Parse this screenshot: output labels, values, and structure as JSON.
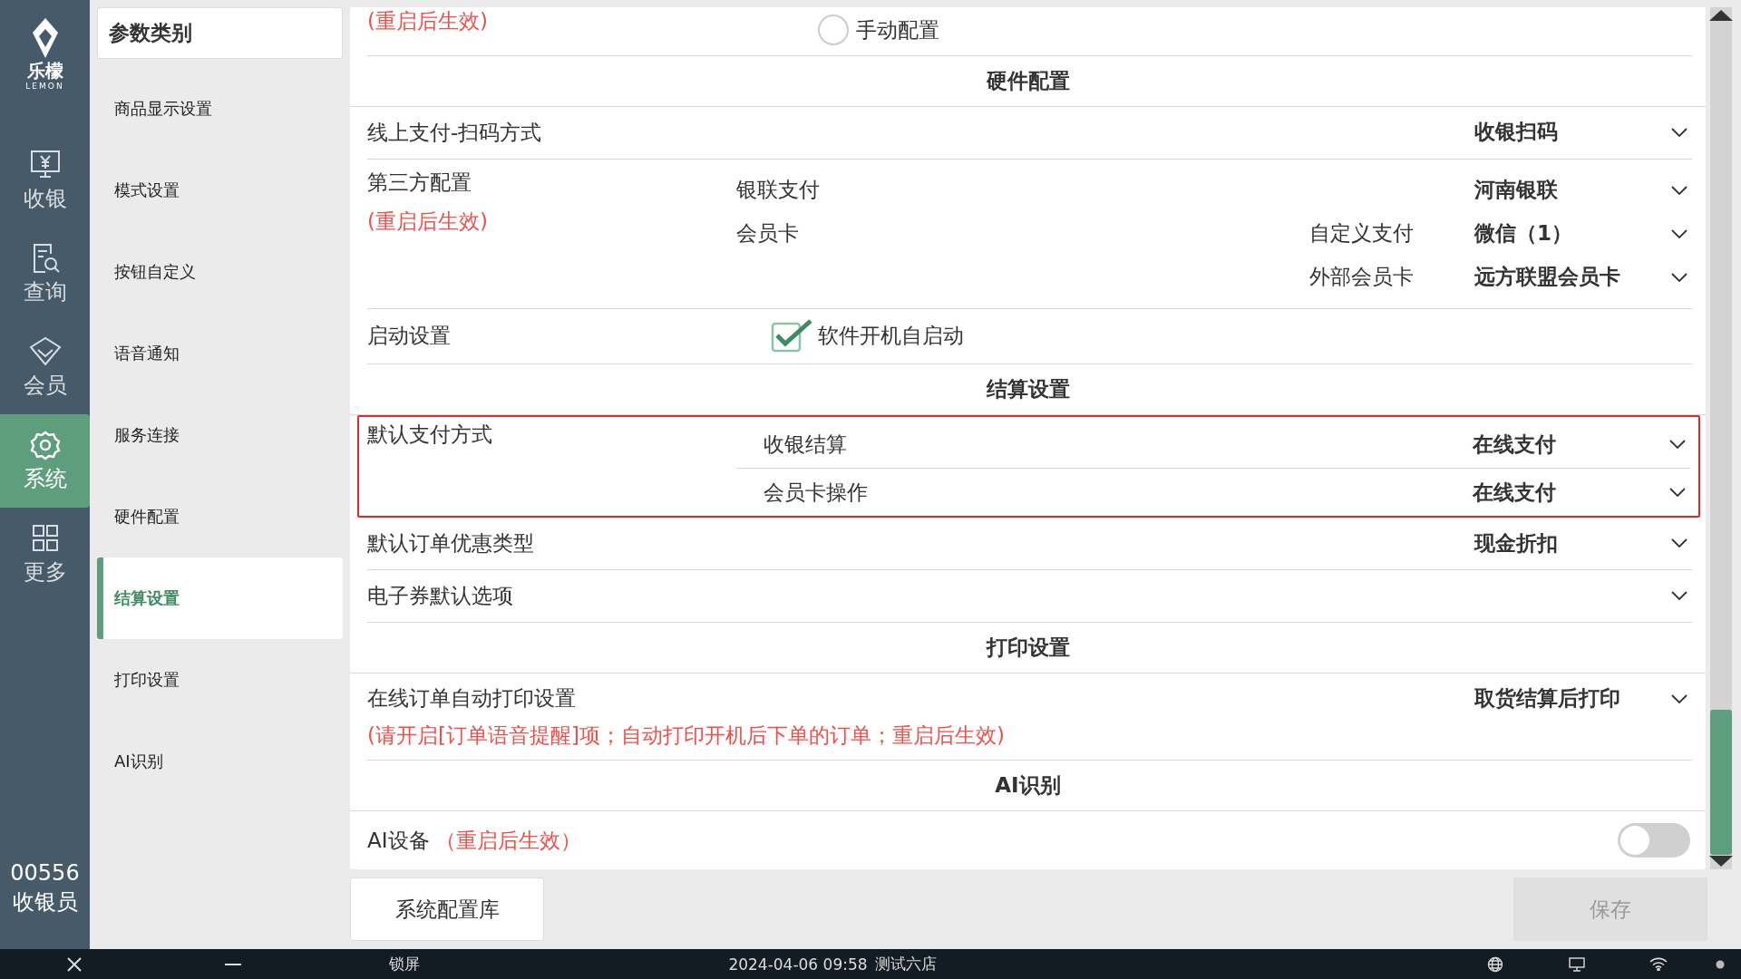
{
  "app": {
    "logo_text": "乐檬",
    "logo_subtext": "LEMON"
  },
  "nav": [
    {
      "label": "收银",
      "kind": "cash",
      "selected": false
    },
    {
      "label": "查询",
      "kind": "search",
      "selected": false
    },
    {
      "label": "会员",
      "kind": "member",
      "selected": false
    },
    {
      "label": "系统",
      "kind": "system",
      "selected": true
    },
    {
      "label": "更多",
      "kind": "more",
      "selected": false
    }
  ],
  "user": {
    "id": "00556",
    "role": "收银员"
  },
  "categories": {
    "title": "参数类别",
    "items": [
      {
        "label": "商品显示设置",
        "selected": false
      },
      {
        "label": "模式设置",
        "selected": false
      },
      {
        "label": "按钮自定义",
        "selected": false
      },
      {
        "label": "语音通知",
        "selected": false
      },
      {
        "label": "服务连接",
        "selected": false
      },
      {
        "label": "硬件配置",
        "selected": false
      },
      {
        "label": "结算设置",
        "selected": true
      },
      {
        "label": "打印设置",
        "selected": false
      },
      {
        "label": "AI识别",
        "selected": false
      }
    ]
  },
  "settings": [
    {
      "kind": "radio_tail",
      "note": "(重启后生效)",
      "option": {
        "label": "手动配置",
        "selected": false
      }
    },
    {
      "kind": "section",
      "title": "硬件配置"
    },
    {
      "kind": "select",
      "label": "线上支付-扫码方式",
      "value": "收银扫码"
    },
    {
      "kind": "group",
      "label": "第三方配置",
      "note": "(重启后生效)",
      "highlighted": false,
      "items": [
        {
          "label": "银联支付",
          "value": "河南银联"
        },
        {
          "label": "会员卡",
          "sublabel": "自定义支付",
          "value": "微信（1）"
        },
        {
          "sublabel": "外部会员卡",
          "value": "远方联盟会员卡"
        }
      ]
    },
    {
      "kind": "checkbox",
      "label": "启动设置",
      "option": {
        "label": "软件开机自启动",
        "checked": true
      }
    },
    {
      "kind": "section",
      "title": "结算设置"
    },
    {
      "kind": "group",
      "label": "默认支付方式",
      "highlighted": true,
      "items": [
        {
          "label": "收银结算",
          "value": "在线支付"
        },
        {
          "label": "会员卡操作",
          "value": "在线支付"
        }
      ]
    },
    {
      "kind": "select",
      "label": "默认订单优惠类型",
      "value": "现金折扣"
    },
    {
      "kind": "select",
      "label": "电子券默认选项"
    },
    {
      "kind": "section",
      "title": "打印设置"
    },
    {
      "kind": "select",
      "label": "在线订单自动打印设置",
      "value": "取货结算后打印",
      "note": "(请开启[订单语音提醒]项；自动打印开机后下单的订单；重启后生效)"
    },
    {
      "kind": "section",
      "title": "AI识别"
    },
    {
      "kind": "toggle",
      "label": "AI设备",
      "note": "（重启后生效）",
      "on": false
    }
  ],
  "buttons": {
    "library": {
      "label": "系统配置库"
    },
    "save": {
      "label": "保存",
      "disabled": true
    }
  },
  "taskbar": {
    "lock": "锁屏",
    "datetime": "2024-04-06 09:58",
    "store": "测试六店"
  }
}
